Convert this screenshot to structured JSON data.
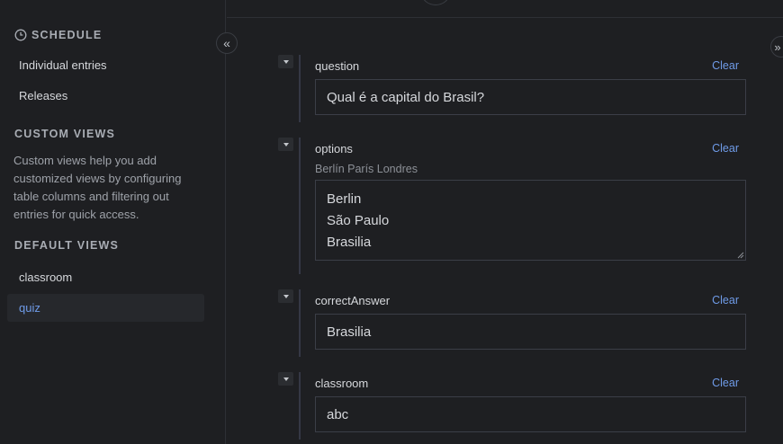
{
  "sidebar": {
    "schedule_header": "SCHEDULE",
    "schedule_items": [
      "Individual entries",
      "Releases"
    ],
    "custom_views_header": "CUSTOM VIEWS",
    "custom_views_desc": "Custom views help you add customized views by configuring table columns and filtering out entries for quick access.",
    "default_views_header": "DEFAULT VIEWS",
    "default_views": [
      "classroom",
      "quiz"
    ],
    "active_view": "quiz"
  },
  "controls": {
    "collapse_icon": "«",
    "expand_icon": "»"
  },
  "fields": [
    {
      "label": "question",
      "clear": "Clear",
      "value": "Qual é a capital do Brasil?"
    },
    {
      "label": "options",
      "clear": "Clear",
      "hint": "Berlín París Londres",
      "lines": [
        "Berlin",
        "São Paulo",
        "Brasilia"
      ]
    },
    {
      "label": "correctAnswer",
      "clear": "Clear",
      "value": "Brasilia"
    },
    {
      "label": "classroom",
      "clear": "Clear",
      "value": "abc"
    }
  ],
  "colors": {
    "accent": "#6f9be8",
    "background": "#1e1f22",
    "border": "#3b3e47"
  }
}
